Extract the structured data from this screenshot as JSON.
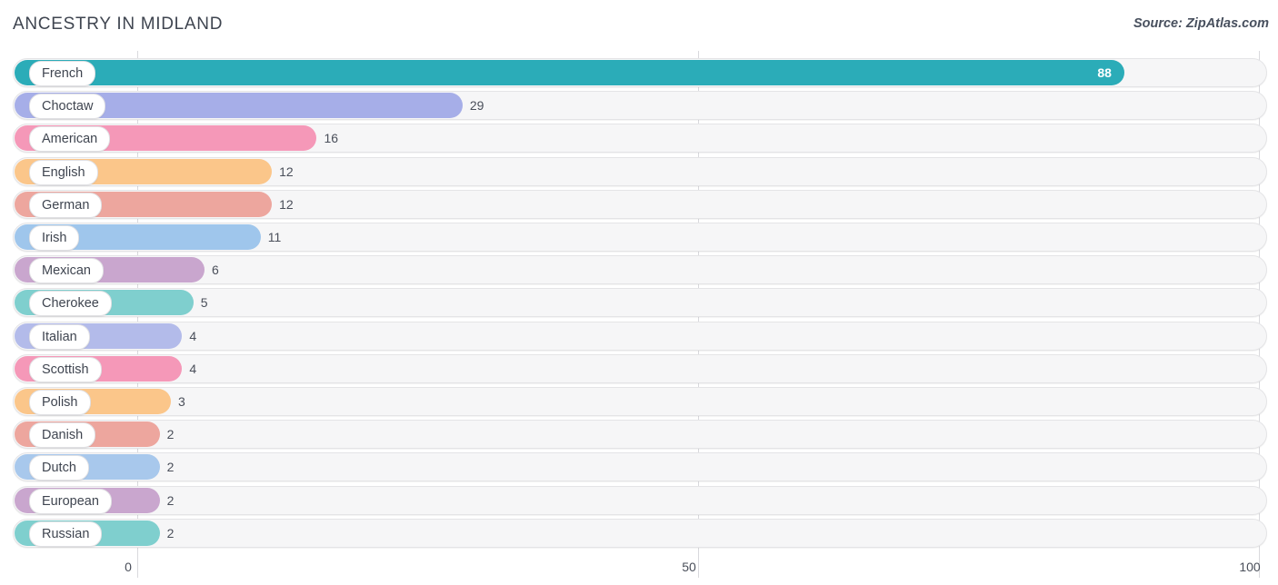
{
  "header": {
    "title": "ANCESTRY IN MIDLAND",
    "source": "Source: ZipAtlas.com"
  },
  "chart_data": {
    "type": "bar",
    "orientation": "horizontal",
    "title": "ANCESTRY IN MIDLAND",
    "xlabel": "",
    "ylabel": "",
    "xlim": [
      0,
      100
    ],
    "xticks": [
      0,
      50,
      100
    ],
    "xtick_labels": [
      "0",
      "50",
      "100"
    ],
    "grid": true,
    "legend": false,
    "categories": [
      "French",
      "Choctaw",
      "American",
      "English",
      "German",
      "Irish",
      "Mexican",
      "Cherokee",
      "Italian",
      "Scottish",
      "Polish",
      "Danish",
      "Dutch",
      "European",
      "Russian"
    ],
    "values": [
      88,
      29,
      16,
      12,
      12,
      11,
      6,
      5,
      4,
      4,
      3,
      2,
      2,
      2,
      2
    ],
    "value_labels": [
      "88",
      "29",
      "16",
      "12",
      "12",
      "11",
      "6",
      "5",
      "4",
      "4",
      "3",
      "2",
      "2",
      "2",
      "2"
    ],
    "colors": [
      "#2bacb8",
      "#a6aee8",
      "#f598b8",
      "#fbc68a",
      "#eda69e",
      "#9fc6ec",
      "#c9a6ce",
      "#7fcfce",
      "#b3bbea",
      "#f598b8",
      "#fbc68a",
      "#eda69e",
      "#a8c8ec",
      "#c9a6ce",
      "#7fcfce"
    ],
    "bars": [
      {
        "label": "French",
        "value": 88,
        "value_label": "88",
        "color": "#2bacb8",
        "label_inside": true
      },
      {
        "label": "Choctaw",
        "value": 29,
        "value_label": "29",
        "color": "#a6aee8",
        "label_inside": false
      },
      {
        "label": "American",
        "value": 16,
        "value_label": "16",
        "color": "#f598b8",
        "label_inside": false
      },
      {
        "label": "English",
        "value": 12,
        "value_label": "12",
        "color": "#fbc68a",
        "label_inside": false
      },
      {
        "label": "German",
        "value": 12,
        "value_label": "12",
        "color": "#eda69e",
        "label_inside": false
      },
      {
        "label": "Irish",
        "value": 11,
        "value_label": "11",
        "color": "#9fc6ec",
        "label_inside": false
      },
      {
        "label": "Mexican",
        "value": 6,
        "value_label": "6",
        "color": "#c9a6ce",
        "label_inside": false
      },
      {
        "label": "Cherokee",
        "value": 5,
        "value_label": "5",
        "color": "#7fcfce",
        "label_inside": false
      },
      {
        "label": "Italian",
        "value": 4,
        "value_label": "4",
        "color": "#b3bbea",
        "label_inside": false
      },
      {
        "label": "Scottish",
        "value": 4,
        "value_label": "4",
        "color": "#f598b8",
        "label_inside": false
      },
      {
        "label": "Polish",
        "value": 3,
        "value_label": "3",
        "color": "#fbc68a",
        "label_inside": false
      },
      {
        "label": "Danish",
        "value": 2,
        "value_label": "2",
        "color": "#eda69e",
        "label_inside": false
      },
      {
        "label": "Dutch",
        "value": 2,
        "value_label": "2",
        "color": "#a8c8ec",
        "label_inside": false
      },
      {
        "label": "European",
        "value": 2,
        "value_label": "2",
        "color": "#c9a6ce",
        "label_inside": false
      },
      {
        "label": "Russian",
        "value": 2,
        "value_label": "2",
        "color": "#7fcfce",
        "label_inside": false
      }
    ]
  },
  "axis": {
    "ticks": [
      {
        "label": "0",
        "value": 0
      },
      {
        "label": "50",
        "value": 50
      },
      {
        "label": "100",
        "value": 100
      }
    ]
  }
}
